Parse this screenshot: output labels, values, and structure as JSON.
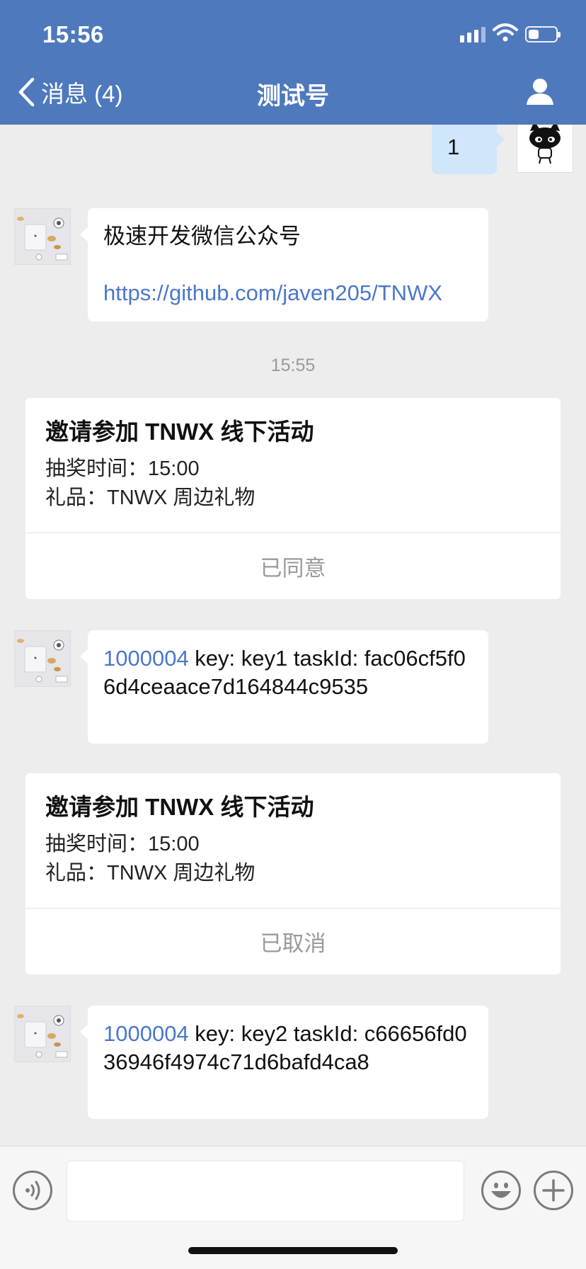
{
  "status_bar": {
    "time": "15:56"
  },
  "nav": {
    "back_label": "消息 (4)",
    "title": "测试号"
  },
  "messages": {
    "me_1": "1",
    "bot_1_line1": "极速开发微信公众号",
    "bot_1_link": "https://github.com/javen205/TNWX",
    "time_divider": "15:55",
    "bot_2_id": "1000004",
    "bot_2_rest": " key: key1 taskId: fac06cf5f06d4ceaace7d164844c9535",
    "bot_3_id": "1000004",
    "bot_3_rest": " key: key2 taskId: c66656fd036946f4974c71d6bafd4ca8"
  },
  "cards": [
    {
      "title": "邀请参加 TNWX 线下活动",
      "line1": "抽奖时间：15:00",
      "line2": "礼品：TNWX 周边礼物",
      "footer": "已同意"
    },
    {
      "title": "邀请参加 TNWX 线下活动",
      "line1": "抽奖时间：15:00",
      "line2": "礼品：TNWX 周边礼物",
      "footer": "已取消"
    }
  ],
  "colors": {
    "header": "#4f79bd",
    "link": "#4a77c9",
    "my_bubble": "#cfe6fb",
    "background": "#ededed"
  },
  "icons": [
    "back-chevron-icon",
    "profile-icon",
    "voice-icon",
    "emoji-icon",
    "plus-icon",
    "signal-icon",
    "wifi-icon",
    "battery-icon"
  ]
}
